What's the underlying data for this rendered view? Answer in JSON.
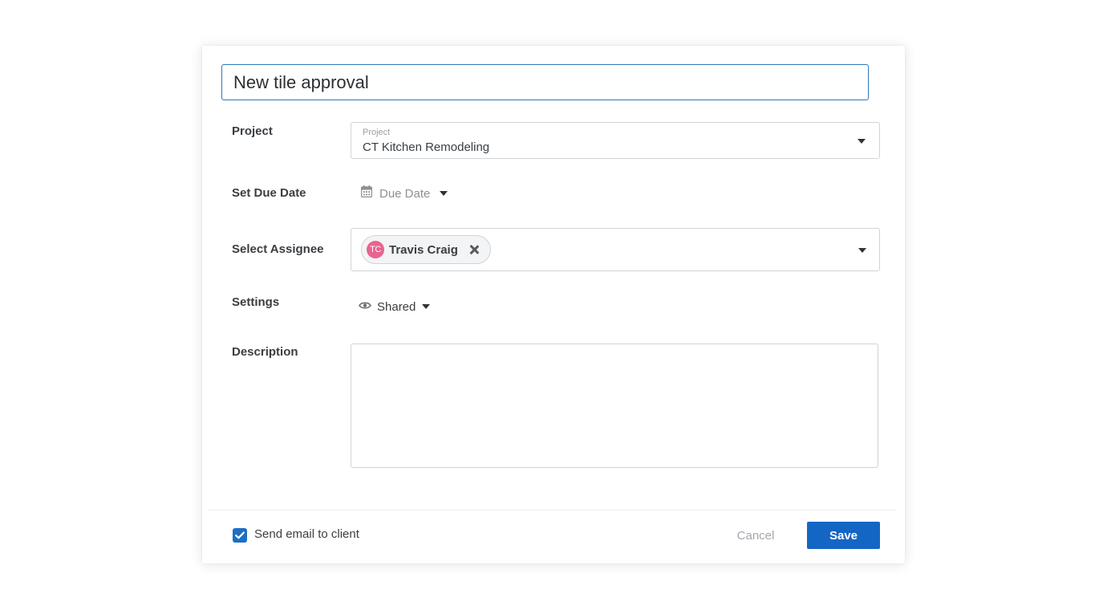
{
  "task": {
    "title_value": "New tile approval"
  },
  "form": {
    "project": {
      "label": "Project",
      "field_label": "Project",
      "value": "CT Kitchen Remodeling"
    },
    "due_date": {
      "label": "Set Due Date",
      "value": "Due Date",
      "icon": "calendar-icon"
    },
    "assignee": {
      "label": "Select Assignee",
      "chip_initials": "TC",
      "chip_name": "Travis Craig",
      "avatar_color": "#e8648f"
    },
    "settings": {
      "label": "Settings",
      "value": "Shared",
      "icon": "eye-icon"
    },
    "description": {
      "label": "Description",
      "value": ""
    }
  },
  "footer": {
    "send_email_label": "Send email to client",
    "send_email_checked": true,
    "cancel_label": "Cancel",
    "save_label": "Save"
  },
  "colors": {
    "accent": "#1466c4",
    "focus_border": "#2f78b7"
  }
}
